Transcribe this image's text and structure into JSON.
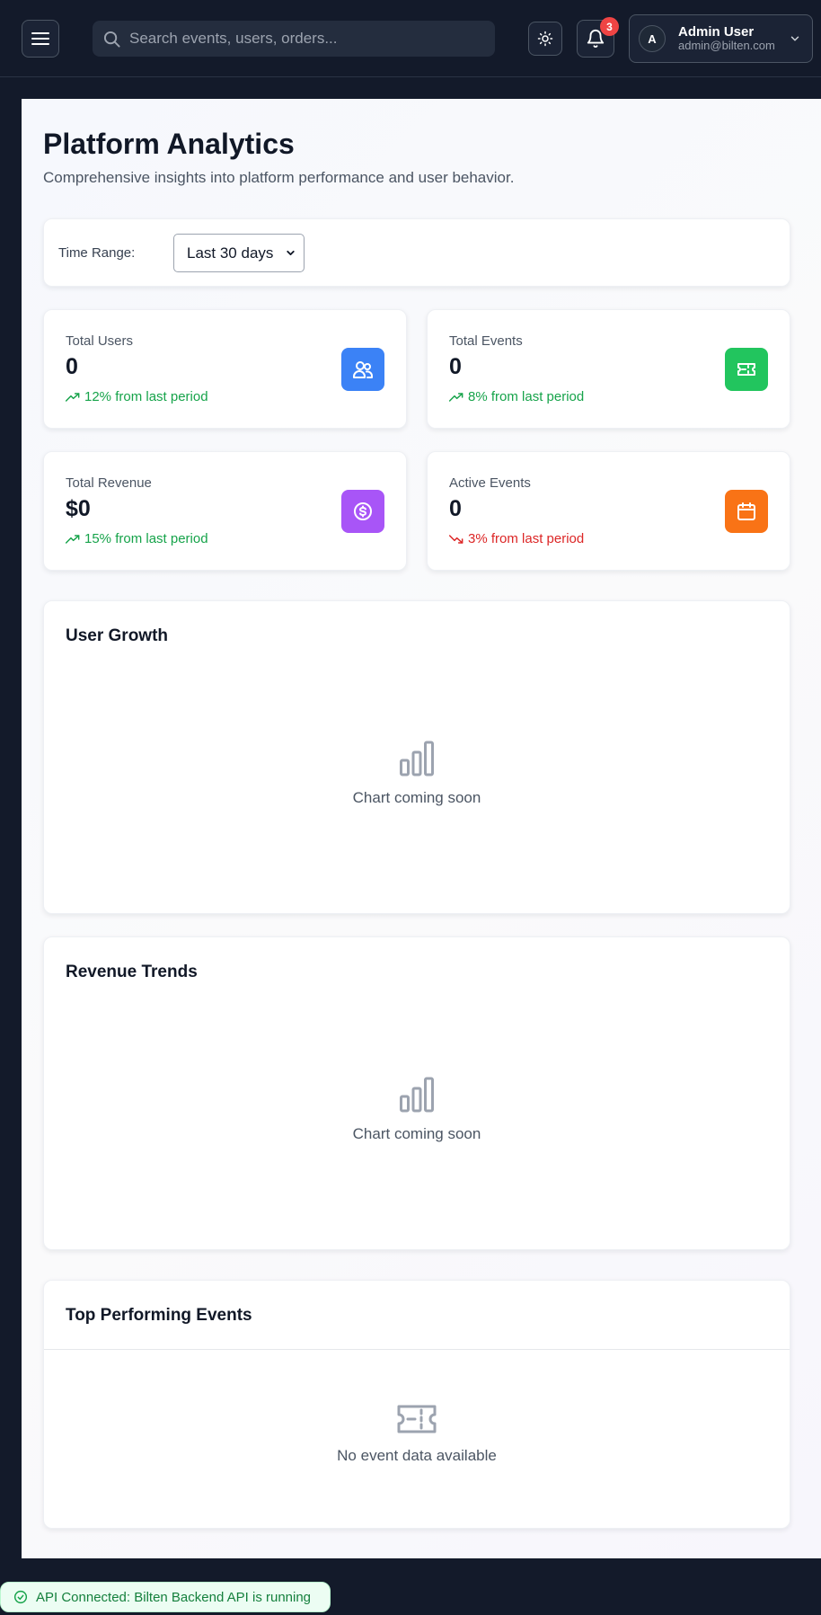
{
  "header": {
    "search_placeholder": "Search events, users, orders...",
    "notification_count": "3",
    "user": {
      "initial": "A",
      "name": "Admin User",
      "email": "admin@bilten.com"
    }
  },
  "page": {
    "title": "Platform Analytics",
    "subtitle": "Comprehensive insights into platform performance and user behavior."
  },
  "filter": {
    "label": "Time Range:",
    "selected": "Last 30 days"
  },
  "stats": [
    {
      "label": "Total Users",
      "value": "0",
      "change": "12% from last period",
      "trend": "up",
      "icon": "users-icon",
      "color": "#3b82f6"
    },
    {
      "label": "Total Events",
      "value": "0",
      "change": "8% from last period",
      "trend": "up",
      "icon": "ticket-icon",
      "color": "#22c55e"
    },
    {
      "label": "Total Revenue",
      "value": "$0",
      "change": "15% from last period",
      "trend": "up",
      "icon": "dollar-icon",
      "color": "#a855f7"
    },
    {
      "label": "Active Events",
      "value": "0",
      "change": "3% from last period",
      "trend": "down",
      "icon": "calendar-icon",
      "color": "#f97316"
    }
  ],
  "charts": {
    "user_growth": {
      "title": "User Growth",
      "placeholder": "Chart coming soon"
    },
    "revenue_trends": {
      "title": "Revenue Trends",
      "placeholder": "Chart coming soon"
    }
  },
  "top_events": {
    "title": "Top Performing Events",
    "empty_text": "No event data available"
  },
  "api_status": {
    "text": "API Connected: Bilten Backend API is running"
  },
  "colors": {
    "trend_up": "#16a34a",
    "trend_down": "#dc2626"
  }
}
